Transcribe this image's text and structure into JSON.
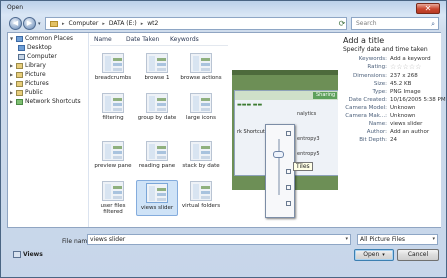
{
  "window": {
    "title": "Open",
    "close_glyph": "✕"
  },
  "nav": {
    "back_glyph": "◀",
    "fwd_glyph": "▶",
    "dropdown_glyph": "▾",
    "refresh_glyph": "⟳"
  },
  "address": {
    "parts": [
      "Computer",
      "DATA (E:)",
      "wt2"
    ],
    "separator": "▸"
  },
  "search": {
    "placeholder": "Search",
    "icon": "search-icon"
  },
  "sidebar": {
    "items": [
      {
        "label": "Common Places",
        "icon": "folder-icon",
        "expanded": true
      },
      {
        "label": "Desktop",
        "icon": "desktop-icon"
      },
      {
        "label": "Computer",
        "icon": "computer-icon"
      },
      {
        "label": "Library",
        "icon": "library-icon"
      },
      {
        "label": "Picture",
        "icon": "picture-icon"
      },
      {
        "label": "Pictures",
        "icon": "pictures-icon"
      },
      {
        "label": "Public",
        "icon": "folder-icon"
      },
      {
        "label": "Network Shortcuts",
        "icon": "network-icon"
      }
    ]
  },
  "columns": [
    "Name",
    "Date Taken",
    "Keywords"
  ],
  "files": [
    {
      "label": "breadcrumbs",
      "selected": false
    },
    {
      "label": "browse 1",
      "selected": false
    },
    {
      "label": "browse actions",
      "selected": false
    },
    {
      "label": "filtering",
      "selected": false
    },
    {
      "label": "group by date",
      "selected": false
    },
    {
      "label": "large icons",
      "selected": false
    },
    {
      "label": "preview pane",
      "selected": false
    },
    {
      "label": "reading pane",
      "selected": false
    },
    {
      "label": "stack by date",
      "selected": false
    },
    {
      "label": "user files filtered",
      "selected": false
    },
    {
      "label": "views slider",
      "selected": true
    },
    {
      "label": "virtual folders",
      "selected": false
    }
  ],
  "preview": {
    "tiles_tooltip": "Tiles",
    "sharing_label": "Sharing",
    "network_shortcuts": "rk Shortcuts",
    "analytics": "nalytics",
    "entropy1": "entropy3",
    "entropy2": "entropy5"
  },
  "details": {
    "title": "Add a title",
    "subtitle": "Specify date and time taken",
    "properties": [
      {
        "key": "Keywords:",
        "value": "Add a keyword"
      },
      {
        "key": "Rating:",
        "value": "☆☆☆☆☆"
      },
      {
        "key": "Dimensions:",
        "value": "237 x 268"
      },
      {
        "key": "Size:",
        "value": "45.2 KB"
      },
      {
        "key": "Type:",
        "value": "PNG Image"
      },
      {
        "key": "Date Created:",
        "value": "10/16/2005 5:38 PM"
      },
      {
        "key": "Camera Model:",
        "value": "Unknown"
      },
      {
        "key": "Camera Mak...:",
        "value": "Unknown"
      },
      {
        "key": "Name:",
        "value": "views slider"
      },
      {
        "key": "Author:",
        "value": "Add an author"
      },
      {
        "key": "Bit Depth:",
        "value": "24"
      }
    ]
  },
  "footer": {
    "file_name_label": "File name:",
    "file_name_value": "views slider",
    "filter_value": "All Picture Files",
    "dropdown_glyph": "▾",
    "views_label": "Views",
    "open_label": "Open",
    "cancel_label": "Cancel"
  }
}
